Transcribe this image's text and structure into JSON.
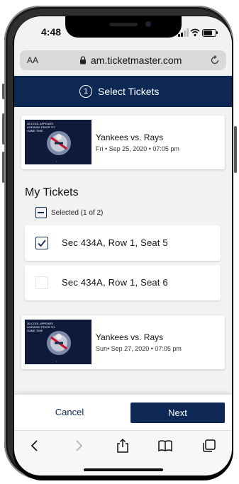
{
  "status_bar": {
    "time": "4:48"
  },
  "browser": {
    "text_size_label": "AA",
    "url": "am.ticketmaster.com"
  },
  "header": {
    "step_number": "1",
    "title": "Select Tickets"
  },
  "events": [
    {
      "title": "Yankees vs. Rays",
      "date": "Fri • Sep 25, 2020 • 07:05 pm",
      "image_caption": "3B COOL APPEARS LIKEWISE PRIOR TO GAME TIME"
    },
    {
      "title": "Yankees vs. Rays",
      "date": "Sun• Sep 27, 2020 • 07:05 pm",
      "image_caption": "3B COOL APPEARS LIKEWISE PRIOR TO GAME TIME"
    }
  ],
  "tickets": {
    "heading": "My Tickets",
    "selected_label": "Selected (1 of 2)",
    "seats": [
      {
        "label": "Sec 434A, Row 1, Seat 5",
        "checked": true
      },
      {
        "label": "Sec 434A, Row 1, Seat 6",
        "checked": false
      }
    ]
  },
  "actions": {
    "cancel_label": "Cancel",
    "next_label": "Next"
  },
  "toolbar_icons": [
    "back-icon",
    "forward-icon",
    "share-icon",
    "bookmarks-icon",
    "tabs-icon"
  ],
  "colors": {
    "brand_navy": "#0d2855",
    "background": "#f2f2f2"
  }
}
